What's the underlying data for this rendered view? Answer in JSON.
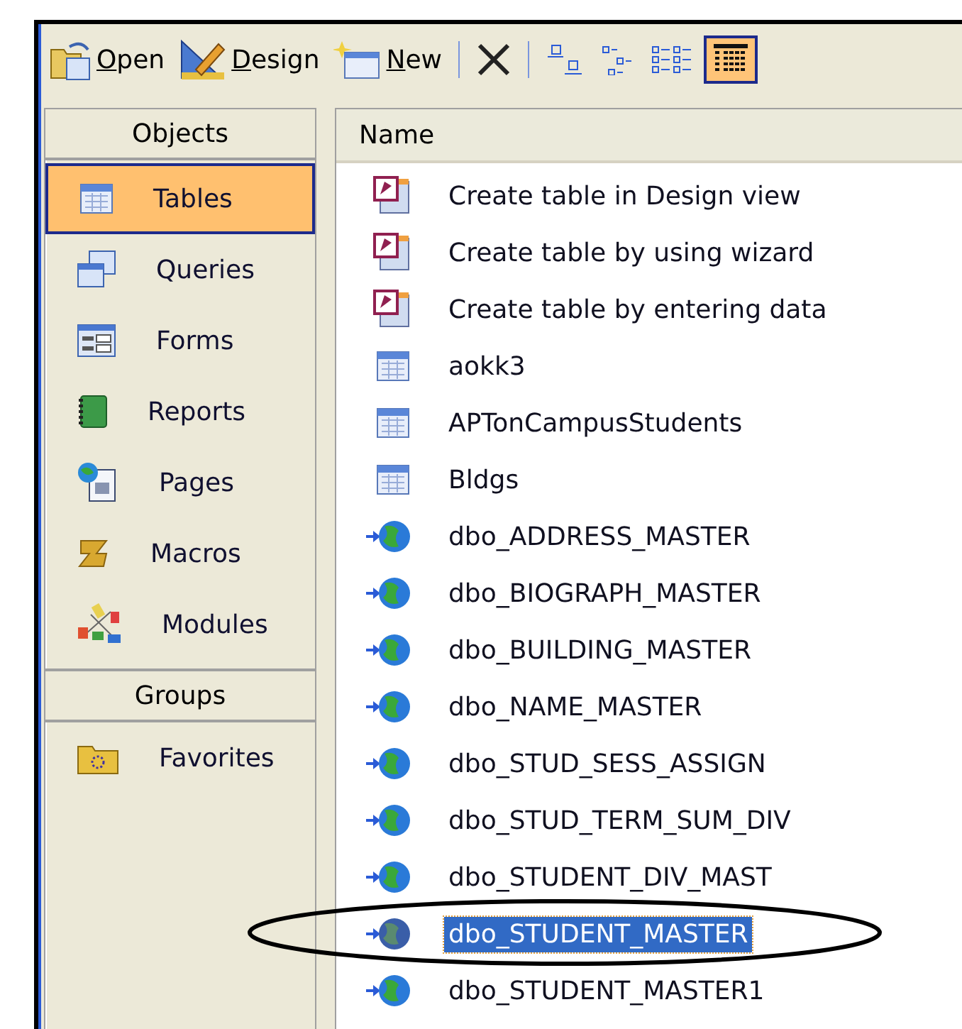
{
  "toolbar": {
    "actions": [
      {
        "kind": "open",
        "label": "Open"
      },
      {
        "kind": "design",
        "label": "Design"
      },
      {
        "kind": "new",
        "label": "New"
      }
    ],
    "view_buttons": [
      {
        "kind": "large",
        "selected": false
      },
      {
        "kind": "small",
        "selected": false
      },
      {
        "kind": "list",
        "selected": false
      },
      {
        "kind": "details",
        "selected": true
      }
    ]
  },
  "objects": {
    "title": "Objects",
    "items": [
      {
        "kind": "tables",
        "label": "Tables",
        "selected": true
      },
      {
        "kind": "queries",
        "label": "Queries",
        "selected": false
      },
      {
        "kind": "forms",
        "label": "Forms",
        "selected": false
      },
      {
        "kind": "reports",
        "label": "Reports",
        "selected": false
      },
      {
        "kind": "pages",
        "label": "Pages",
        "selected": false
      },
      {
        "kind": "macros",
        "label": "Macros",
        "selected": false
      },
      {
        "kind": "modules",
        "label": "Modules",
        "selected": false
      }
    ]
  },
  "groups": {
    "title": "Groups",
    "items": [
      {
        "kind": "favorites",
        "label": "Favorites",
        "selected": false
      }
    ]
  },
  "list": {
    "column": "Name",
    "rows": [
      {
        "kind": "shortcut",
        "name": "Create table in Design view",
        "selected": false
      },
      {
        "kind": "shortcut",
        "name": "Create table by using wizard",
        "selected": false
      },
      {
        "kind": "shortcut",
        "name": "Create table by entering data",
        "selected": false
      },
      {
        "kind": "table",
        "name": "aokk3",
        "selected": false
      },
      {
        "kind": "table",
        "name": "APTonCampusStudents",
        "selected": false
      },
      {
        "kind": "table",
        "name": "Bldgs",
        "selected": false
      },
      {
        "kind": "linked",
        "name": "dbo_ADDRESS_MASTER",
        "selected": false
      },
      {
        "kind": "linked",
        "name": "dbo_BIOGRAPH_MASTER",
        "selected": false
      },
      {
        "kind": "linked",
        "name": "dbo_BUILDING_MASTER",
        "selected": false
      },
      {
        "kind": "linked",
        "name": "dbo_NAME_MASTER",
        "selected": false
      },
      {
        "kind": "linked",
        "name": "dbo_STUD_SESS_ASSIGN",
        "selected": false
      },
      {
        "kind": "linked",
        "name": "dbo_STUD_TERM_SUM_DIV",
        "selected": false
      },
      {
        "kind": "linked",
        "name": "dbo_STUDENT_DIV_MAST",
        "selected": false
      },
      {
        "kind": "linked",
        "name": "dbo_STUDENT_MASTER",
        "selected": true
      },
      {
        "kind": "linked",
        "name": "dbo_STUDENT_MASTER1",
        "selected": false
      }
    ]
  }
}
